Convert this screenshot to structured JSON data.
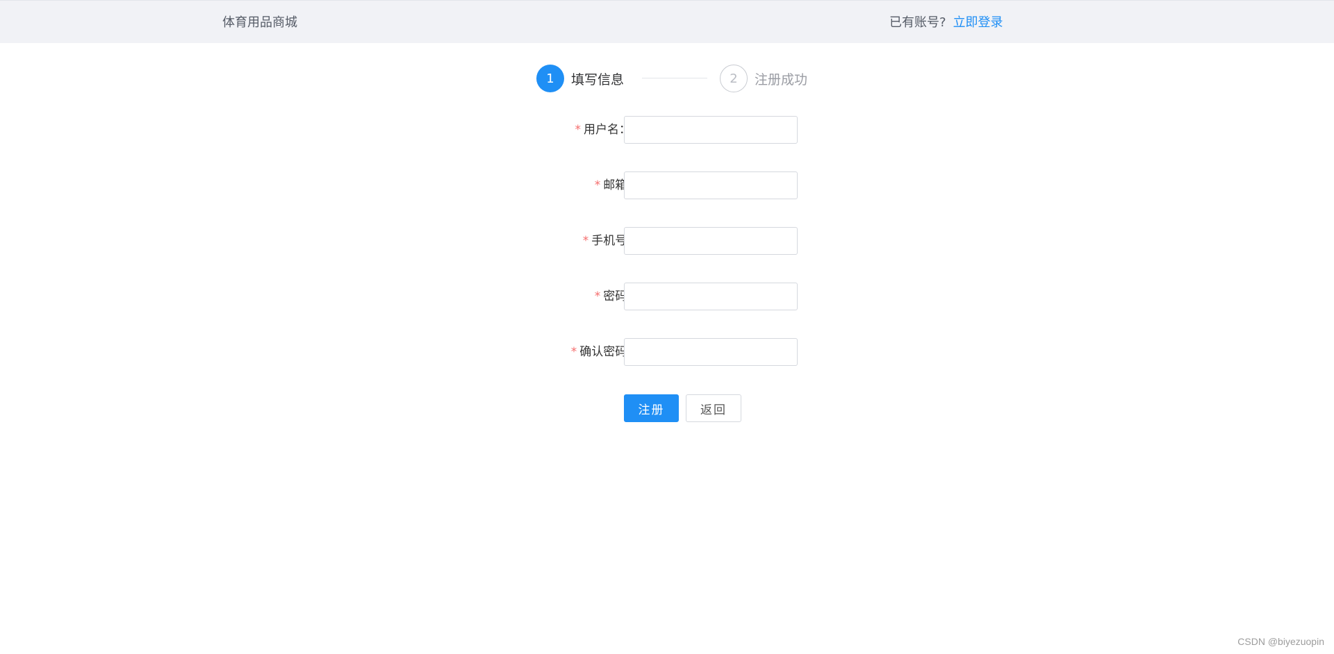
{
  "header": {
    "brand": "体育用品商城",
    "login_prompt": "已有账号?",
    "login_link": "立即登录"
  },
  "steps": [
    {
      "number": "1",
      "label": "填写信息",
      "state": "active"
    },
    {
      "number": "2",
      "label": "注册成功",
      "state": "pending"
    }
  ],
  "form": {
    "required_mark": "*",
    "fields": [
      {
        "label": "用户名：",
        "value": ""
      },
      {
        "label": "邮箱:",
        "value": ""
      },
      {
        "label": "手机号:",
        "value": ""
      },
      {
        "label": "密码:",
        "value": ""
      },
      {
        "label": "确认密码:",
        "value": ""
      }
    ]
  },
  "actions": {
    "register_label": "注册",
    "back_label": "返回"
  },
  "watermark": "CSDN @biyezuopin",
  "colors": {
    "primary": "#1f8ff5",
    "required": "#f56c6c",
    "header_bg": "#f1f2f6"
  }
}
